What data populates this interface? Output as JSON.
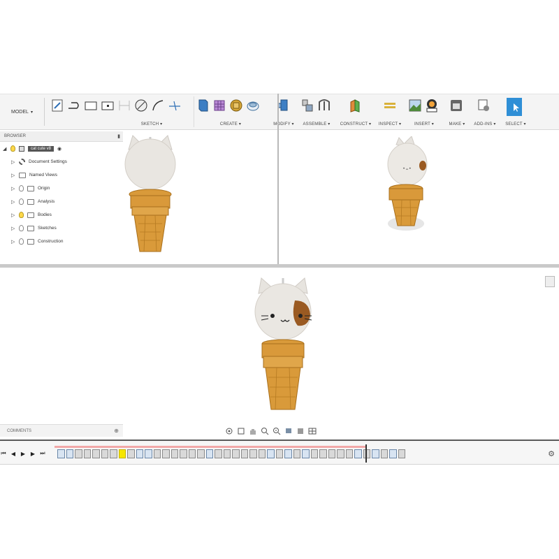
{
  "toolbar": {
    "workspace": {
      "label": "MODEL",
      "caret": "▾"
    },
    "groups": [
      {
        "label": "SKETCH ▾",
        "icons": [
          "sketch-create-icon",
          "line-icon",
          "rectangle-icon",
          "slot-icon",
          "projection-icon",
          "circle-icon",
          "arc-icon",
          "trim-icon"
        ]
      },
      {
        "label": "CREATE ▾",
        "icons": [
          "extrude-icon",
          "box-pattern-icon",
          "revolve-icon",
          "sweep-icon"
        ]
      },
      {
        "label": "MODIFY ▾",
        "icons": [
          "press-pull-icon"
        ]
      },
      {
        "label": "ASSEMBLE ▾",
        "icons": [
          "new-component-icon",
          "joint-icon"
        ]
      },
      {
        "label": "CONSTRUCT ▾",
        "icons": [
          "offset-plane-icon"
        ]
      },
      {
        "label": "INSPECT ▾",
        "icons": [
          "measure-icon"
        ]
      },
      {
        "label": "INSERT ▾",
        "icons": [
          "insert-image-icon",
          "insert-mesh-icon"
        ]
      },
      {
        "label": "MAKE ▾",
        "icons": [
          "3d-print-icon"
        ]
      },
      {
        "label": "ADD-INS ▾",
        "icons": [
          "scripts-icon"
        ]
      },
      {
        "label": "SELECT ▾",
        "icons": [
          "select-arrow-icon"
        ]
      }
    ]
  },
  "browser": {
    "title": "BROWSER",
    "root": "cat cute v8",
    "items": [
      "Document Settings",
      "Named Views",
      "Origin",
      "Analysis",
      "Bodies",
      "Sketches",
      "Construction"
    ]
  },
  "comments": {
    "title": "COMMENTS"
  },
  "colors": {
    "cone": "#d99a3a",
    "cone_dark": "#b57a22",
    "head": "#ebe8e4",
    "patch": "#9a5a22",
    "select_button": "#2f8fd6",
    "timeline_highlight": "#f6e600"
  },
  "timeline_icons": [
    "b",
    "b",
    "g",
    "g",
    "g",
    "g",
    "g",
    "y",
    "g",
    "b",
    "b",
    "g",
    "g",
    "g",
    "g",
    "g",
    "g",
    "b",
    "g",
    "g",
    "g",
    "g",
    "g",
    "g",
    "b",
    "g",
    "b",
    "g",
    "b",
    "g",
    "g",
    "g",
    "g",
    "g",
    "b",
    "g",
    "b",
    "g",
    "b",
    "g"
  ]
}
